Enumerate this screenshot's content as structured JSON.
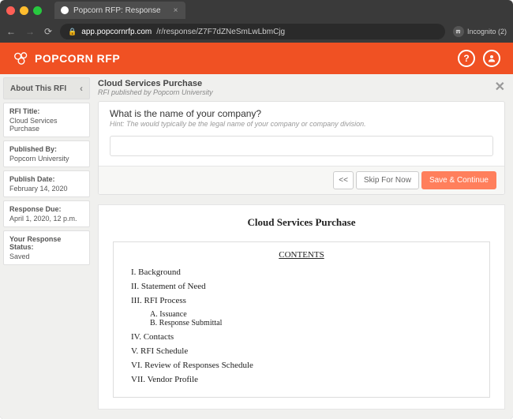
{
  "browser": {
    "tab_title": "Popcorn RFP: Response",
    "url_host": "app.popcornrfp.com",
    "url_path": "/r/response/Z7F7dZNeSmLwLbmCjg",
    "incognito_label": "Incognito (2)"
  },
  "header": {
    "brand": "POPCORN RFP"
  },
  "sidebar": {
    "title": "About This RFI",
    "items": [
      {
        "label": "RFI Title:",
        "value": "Cloud Services Purchase"
      },
      {
        "label": "Published By:",
        "value": "Popcorn University"
      },
      {
        "label": "Publish Date:",
        "value": "February 14, 2020"
      },
      {
        "label": "Response Due:",
        "value": "April 1, 2020, 12 p.m."
      },
      {
        "label": "Your Response Status:",
        "value": "Saved"
      }
    ]
  },
  "main": {
    "title": "Cloud Services Purchase",
    "subtitle": "RFI published by Popcorn University",
    "question": {
      "title": "What is the name of your company?",
      "hint": "Hint: The would typically be the legal name of your company or company division.",
      "value": ""
    },
    "buttons": {
      "prev": "<<",
      "skip": "Skip For Now",
      "save": "Save & Continue"
    }
  },
  "document": {
    "title": "Cloud Services Purchase",
    "toc_heading": "CONTENTS",
    "toc": [
      {
        "num": "I.",
        "text": "Background"
      },
      {
        "num": "II.",
        "text": "Statement of Need"
      },
      {
        "num": "III.",
        "text": "RFI Process",
        "subs": [
          {
            "num": "A.",
            "text": "Issuance"
          },
          {
            "num": "B.",
            "text": "Response Submittal"
          }
        ]
      },
      {
        "num": "IV.",
        "text": "Contacts"
      },
      {
        "num": "V.",
        "text": "RFI Schedule"
      },
      {
        "num": "VI.",
        "text": "Review of Responses Schedule"
      },
      {
        "num": "VII.",
        "text": "Vendor Profile"
      }
    ]
  }
}
